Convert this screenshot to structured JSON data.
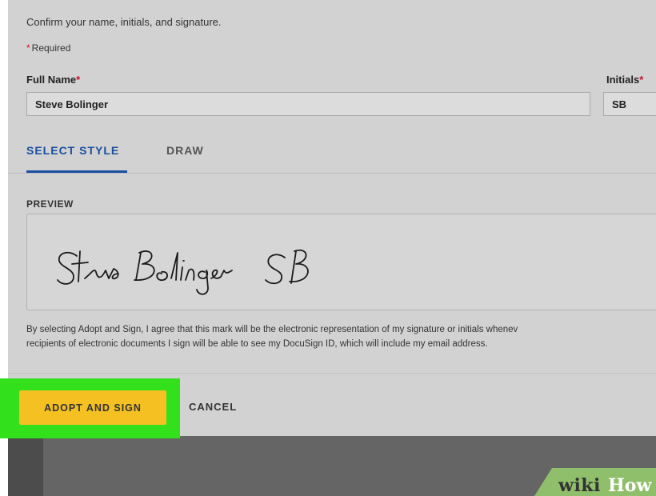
{
  "dialog": {
    "instructions": "Confirm your name, initials, and signature.",
    "required_note": "Required",
    "required_star": "*",
    "full_name_label": "Full Name",
    "full_name_value": "Steve Bolinger",
    "initials_label": "Initials",
    "initials_value": "SB"
  },
  "tabs": {
    "select_style": "SELECT STYLE",
    "draw": "DRAW",
    "active": "SELECT STYLE"
  },
  "preview": {
    "label": "PREVIEW",
    "signature_text": "Steve Bolinger",
    "initials_text": "SB"
  },
  "disclaimer": {
    "line1": "By selecting Adopt and Sign, I agree that this mark will be the electronic representation of my signature or initials whenev",
    "line2": "recipients of electronic documents I sign will be able to see my DocuSign ID, which will include my email address."
  },
  "footer": {
    "adopt_label": "ADOPT AND SIGN",
    "cancel_label": "CANCEL"
  },
  "watermark": {
    "wiki": "wiki",
    "how": "How"
  },
  "colors": {
    "accent": "#1a4fa0",
    "adopt_button": "#f5c022",
    "highlight": "#33e01c",
    "required": "#c8102e"
  }
}
